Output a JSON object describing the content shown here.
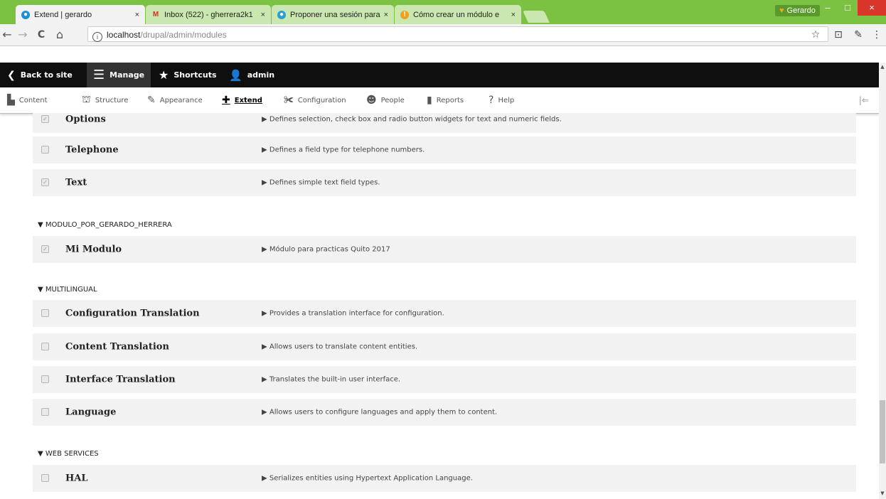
{
  "browser": {
    "tabs": [
      {
        "label": "Extend | gerardo",
        "close": "×",
        "icon": "drupal-icon"
      },
      {
        "label": "Inbox (522) - gherrera2k1",
        "close": "×",
        "icon": "gmail-icon"
      },
      {
        "label": "Proponer una sesión para",
        "close": "×",
        "icon": "drupal-icon"
      },
      {
        "label": "Cómo crear un módulo e",
        "close": "×",
        "icon": "info-icon"
      }
    ],
    "user_badge": "Gerardo",
    "window_controls": {
      "minimize": "–",
      "maximize": "□",
      "close": "×"
    },
    "nav": {
      "back": "←",
      "forward": "→",
      "reload": "C",
      "home": "⌂"
    },
    "url": {
      "info": "i",
      "host": "localhost",
      "path": "/drupal/admin/modules"
    },
    "toolbar_icons": {
      "star": "☆",
      "cast": "⊡",
      "extension": "✎",
      "menu": "⋮"
    }
  },
  "admin_toolbar": {
    "back_to_site": "Back to site",
    "manage": "Manage",
    "shortcuts": "Shortcuts",
    "user": "admin"
  },
  "admin_tray": {
    "items": [
      "Content",
      "Structure",
      "Appearance",
      "Extend",
      "Configuration",
      "People",
      "Reports",
      "Help"
    ],
    "active": "Extend",
    "collapse_icon": "|⇐"
  },
  "modules": [
    {
      "name": "Options",
      "description": "▶ Defines selection, check box and radio button widgets for text and numeric fields.",
      "checked": true
    },
    {
      "name": "Telephone",
      "description": "▶ Defines a field type for telephone numbers.",
      "checked": false
    },
    {
      "name": "Text",
      "description": "▶ Defines simple text field types.",
      "checked": true
    },
    {
      "group": "▼ MODULO_POR_GERARDO_HERRERA"
    },
    {
      "name": "Mi Modulo",
      "description": "▶ Módulo para practicas Quito 2017",
      "checked": true
    },
    {
      "group": "▼ MULTILINGUAL"
    },
    {
      "name": "Configuration Translation",
      "description": "▶ Provides a translation interface for configuration.",
      "checked": false
    },
    {
      "name": "Content Translation",
      "description": "▶ Allows users to translate content entities.",
      "checked": false
    },
    {
      "name": "Interface Translation",
      "description": "▶ Translates the built-in user interface.",
      "checked": false
    },
    {
      "name": "Language",
      "description": "▶ Allows users to configure languages and apply them to content.",
      "checked": false
    },
    {
      "group": "▼ WEB SERVICES"
    },
    {
      "name": "HAL",
      "description": "▶ Serializes entities using Hypertext Application Language.",
      "checked": false
    }
  ],
  "colors": {
    "browser_frame": "#7cc242",
    "toolbar_bg": "#0f0f0f",
    "row_bg": "#f2f2f2",
    "close_button": "#d9352a"
  }
}
